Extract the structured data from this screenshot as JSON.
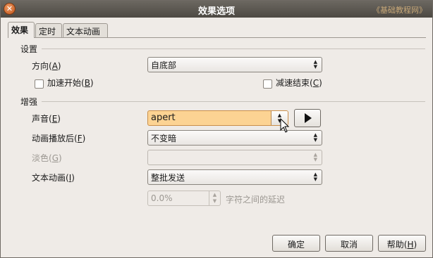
{
  "window": {
    "title": "效果选项",
    "watermark": "《基础教程网》",
    "close_glyph": "✕"
  },
  "tabs": [
    {
      "label": "效果",
      "active": true
    },
    {
      "label": "定时",
      "active": false
    },
    {
      "label": "文本动画",
      "active": false
    }
  ],
  "settings": {
    "section_label": "设置",
    "direction": {
      "label_pre": "方向(",
      "mnemonic": "A",
      "label_post": ")",
      "value": "自底部"
    },
    "accelerate": {
      "label_pre": "加速开始(",
      "mnemonic": "B",
      "label_post": ")",
      "checked": false
    },
    "decelerate": {
      "label_pre": "减速结束(",
      "mnemonic": "C",
      "label_post": ")",
      "checked": false
    }
  },
  "enhance": {
    "section_label": "增强",
    "sound": {
      "label_pre": "声音(",
      "mnemonic": "E",
      "label_post": ")",
      "value": "apert"
    },
    "after_animation": {
      "label_pre": "动画播放后(",
      "mnemonic": "F",
      "label_post": ")",
      "value": "不变暗"
    },
    "dim_color": {
      "label_pre": "淡色(",
      "mnemonic": "G",
      "label_post": ")",
      "value": "",
      "disabled": true
    },
    "text_animation": {
      "label_pre": "文本动画(",
      "mnemonic": "I",
      "label_post": ")",
      "value": "整批发送"
    },
    "delay": {
      "value": "0.0%",
      "suffix": "字符之间的延迟",
      "disabled": true
    }
  },
  "buttons": {
    "ok": "确定",
    "cancel": "取消",
    "help_pre": "帮助(",
    "help_mnemonic": "H",
    "help_post": ")"
  },
  "colors": {
    "titlebar": "#4d4943",
    "highlight_field": "#fcd393",
    "window_bg": "#efebe7"
  }
}
